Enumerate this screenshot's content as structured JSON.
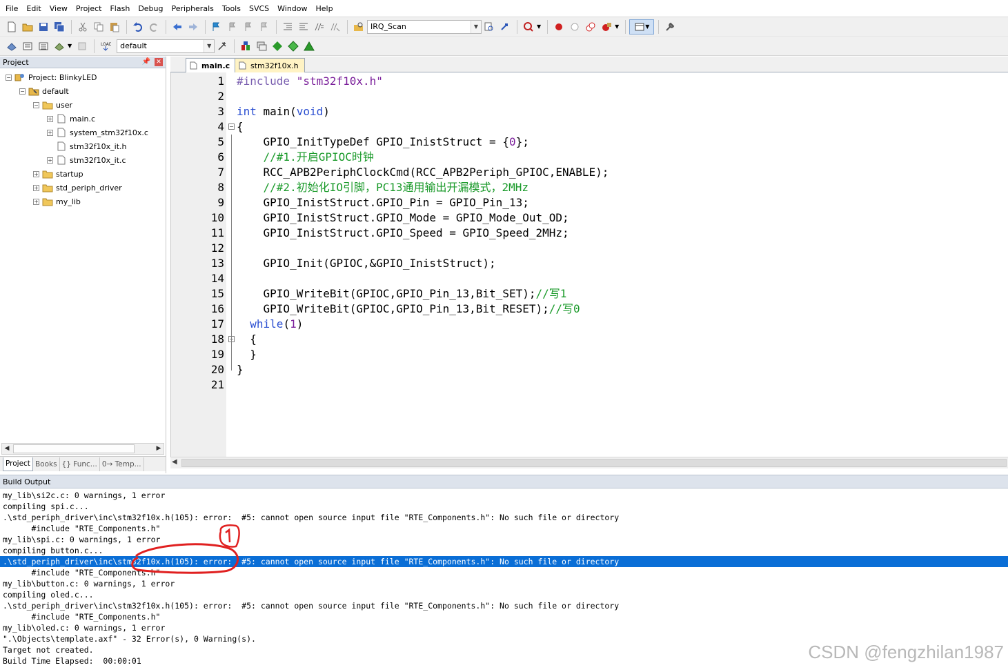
{
  "menu": [
    "File",
    "Edit",
    "View",
    "Project",
    "Flash",
    "Debug",
    "Peripherals",
    "Tools",
    "SVCS",
    "Window",
    "Help"
  ],
  "toolbar": {
    "find_combo": "IRQ_Scan",
    "target_combo": "default"
  },
  "project_panel": {
    "title": "Project",
    "tree": [
      {
        "label": "Project: BlinkyLED",
        "level": 0,
        "expander": "−",
        "icon": "project-icon"
      },
      {
        "label": "default",
        "level": 1,
        "expander": "−",
        "icon": "target-folder-icon"
      },
      {
        "label": "user",
        "level": 2,
        "expander": "−",
        "icon": "folder-icon"
      },
      {
        "label": "main.c",
        "level": 3,
        "expander": "+",
        "icon": "file-icon"
      },
      {
        "label": "system_stm32f10x.c",
        "level": 3,
        "expander": "+",
        "icon": "file-icon"
      },
      {
        "label": "stm32f10x_it.h",
        "level": 3,
        "expander": "",
        "icon": "file-icon"
      },
      {
        "label": "stm32f10x_it.c",
        "level": 3,
        "expander": "+",
        "icon": "file-icon"
      },
      {
        "label": "startup",
        "level": 2,
        "expander": "+",
        "icon": "folder-icon"
      },
      {
        "label": "std_periph_driver",
        "level": 2,
        "expander": "+",
        "icon": "folder-icon"
      },
      {
        "label": "my_lib",
        "level": 2,
        "expander": "+",
        "icon": "folder-icon"
      }
    ],
    "tabs": [
      "Project",
      "Books",
      "{} Func...",
      "0→ Temp..."
    ]
  },
  "editor": {
    "tabs": [
      {
        "label": "main.c",
        "active": true
      },
      {
        "label": "stm32f10x.h",
        "active": false
      }
    ],
    "lines": [
      [
        [
          "pp",
          "#include "
        ],
        [
          "str",
          "\"stm32f10x.h\""
        ]
      ],
      [],
      [
        [
          "kw",
          "int"
        ],
        [
          "tx",
          " main("
        ],
        [
          "kw",
          "void"
        ],
        [
          "tx",
          ")"
        ]
      ],
      [
        [
          "tx",
          "{"
        ]
      ],
      [
        [
          "tx",
          "    GPIO_InitTypeDef GPIO_InistStruct = {"
        ],
        [
          "num",
          "0"
        ],
        [
          "tx",
          "};"
        ]
      ],
      [
        [
          "cm",
          "    //#1.开启GPIOC时钟"
        ]
      ],
      [
        [
          "tx",
          "    RCC_APB2PeriphClockCmd(RCC_APB2Periph_GPIOC,ENABLE);"
        ]
      ],
      [
        [
          "cm",
          "    //#2.初始化IO引脚，PC13通用输出开漏模式，2MHz"
        ]
      ],
      [
        [
          "tx",
          "    GPIO_InistStruct.GPIO_Pin = GPIO_Pin_13;"
        ]
      ],
      [
        [
          "tx",
          "    GPIO_InistStruct.GPIO_Mode = GPIO_Mode_Out_OD;"
        ]
      ],
      [
        [
          "tx",
          "    GPIO_InistStruct.GPIO_Speed = GPIO_Speed_2MHz;"
        ]
      ],
      [],
      [
        [
          "tx",
          "    GPIO_Init(GPIOC,&GPIO_InistStruct);"
        ]
      ],
      [],
      [
        [
          "tx",
          "    GPIO_WriteBit(GPIOC,GPIO_Pin_13,Bit_SET);"
        ],
        [
          "cm",
          "//写1"
        ]
      ],
      [
        [
          "tx",
          "    GPIO_WriteBit(GPIOC,GPIO_Pin_13,Bit_RESET);"
        ],
        [
          "cm",
          "//写0"
        ]
      ],
      [
        [
          "tx",
          "  "
        ],
        [
          "kw",
          "while"
        ],
        [
          "tx",
          "("
        ],
        [
          "num",
          "1"
        ],
        [
          "tx",
          ")"
        ]
      ],
      [
        [
          "tx",
          "  {"
        ]
      ],
      [
        [
          "tx",
          "  }"
        ]
      ],
      [
        [
          "tx",
          "}"
        ]
      ],
      []
    ],
    "line_numbers": [
      "1",
      "2",
      "3",
      "4",
      "5",
      "6",
      "7",
      "8",
      "9",
      "10",
      "11",
      "12",
      "13",
      "14",
      "15",
      "16",
      "17",
      "18",
      "19",
      "20",
      "21"
    ]
  },
  "build_output": {
    "title": "Build Output",
    "selected_index": 6,
    "lines": [
      "my_lib\\si2c.c: 0 warnings, 1 error",
      "compiling spi.c...",
      ".\\std_periph_driver\\inc\\stm32f10x.h(105): error:  #5: cannot open source input file \"RTE_Components.h\": No such file or directory",
      "      #include \"RTE_Components.h\"",
      "my_lib\\spi.c: 0 warnings, 1 error",
      "compiling button.c...",
      ".\\std_periph_driver\\inc\\stm32f10x.h(105): error:  #5: cannot open source input file \"RTE_Components.h\": No such file or directory",
      "      #include \"RTE_Components.h\"",
      "my_lib\\button.c: 0 warnings, 1 error",
      "compiling oled.c...",
      ".\\std_periph_driver\\inc\\stm32f10x.h(105): error:  #5: cannot open source input file \"RTE_Components.h\": No such file or directory",
      "      #include \"RTE_Components.h\"",
      "my_lib\\oled.c: 0 warnings, 1 error",
      "\".\\Objects\\template.axf\" - 32 Error(s), 0 Warning(s).",
      "Target not created.",
      "Build Time Elapsed:  00:00:01"
    ]
  },
  "colors": {
    "selection": "#0a6ed6",
    "keyword": "#2b4fd1",
    "comment": "#1a9a2a",
    "string": "#7a1e9a",
    "annotation": "#e02020"
  },
  "watermark": "CSDN @fengzhilan1987"
}
